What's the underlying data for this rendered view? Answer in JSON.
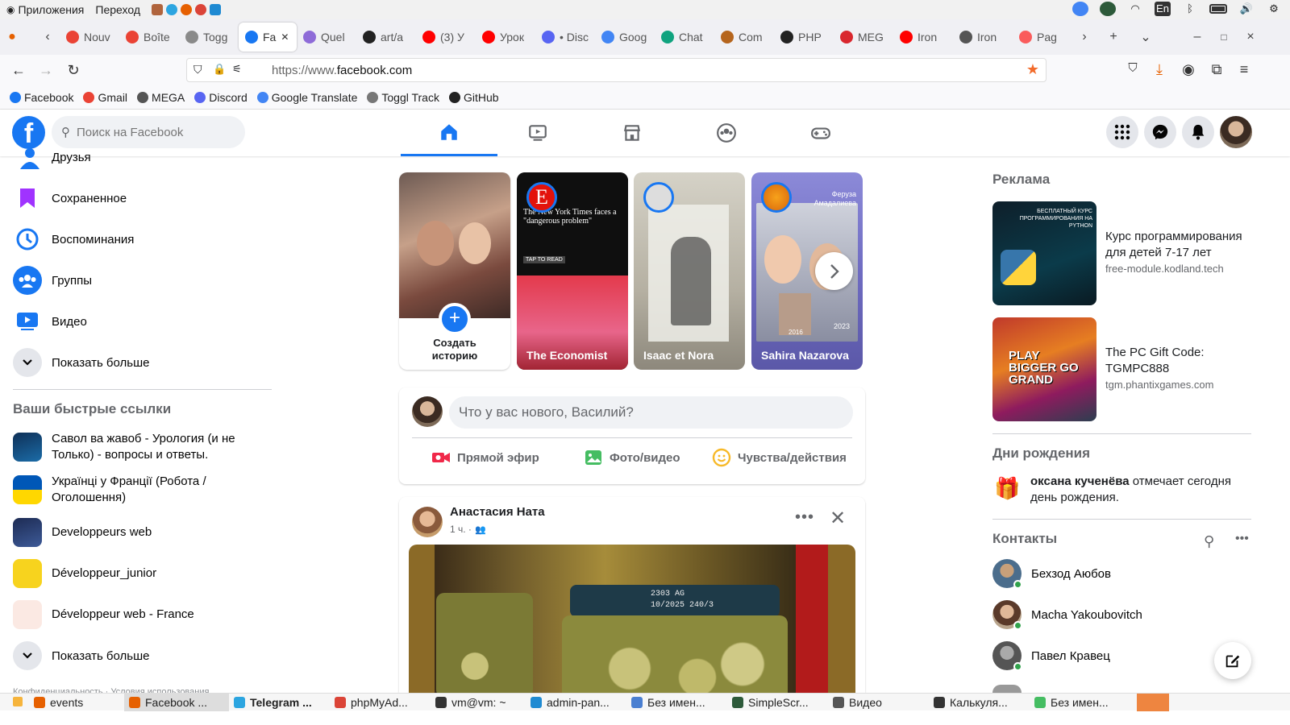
{
  "system_bar": {
    "menu_apps": "Приложения",
    "menu_go": "Переход",
    "keyboard_layout": "En"
  },
  "browser": {
    "tabs": [
      {
        "label": "Nouv",
        "icon": "gmail"
      },
      {
        "label": "Boîte",
        "icon": "gmail"
      },
      {
        "label": "Togg",
        "icon": "toggl"
      },
      {
        "label": "Fa",
        "icon": "facebook"
      },
      {
        "label": "Quel",
        "icon": "quel"
      },
      {
        "label": "art/a",
        "icon": "github"
      },
      {
        "label": "(3) У",
        "icon": "youtube"
      },
      {
        "label": "Урок",
        "icon": "youtube"
      },
      {
        "label": "• Disc",
        "icon": "discord"
      },
      {
        "label": "Goog",
        "icon": "translate"
      },
      {
        "label": "Chat",
        "icon": "chatgpt"
      },
      {
        "label": "Com",
        "icon": "com"
      },
      {
        "label": "PHP",
        "icon": "github"
      },
      {
        "label": "MEG",
        "icon": "mega"
      },
      {
        "label": "Iron",
        "icon": "youtube"
      },
      {
        "label": "Iron",
        "icon": "wikipedia"
      },
      {
        "label": "Pag",
        "icon": "itsy"
      }
    ],
    "url_prefix": "https://www.",
    "url_domain": "facebook.com",
    "bookmarks": [
      {
        "label": "Facebook",
        "icon": "facebook"
      },
      {
        "label": "Gmail",
        "icon": "google"
      },
      {
        "label": "MEGA",
        "icon": "globe"
      },
      {
        "label": "Discord",
        "icon": "discord"
      },
      {
        "label": "Google Translate",
        "icon": "translate"
      },
      {
        "label": "Toggl Track",
        "icon": "toggl"
      },
      {
        "label": "GitHub",
        "icon": "github"
      }
    ]
  },
  "fb": {
    "logo": "f",
    "search_placeholder": "Поиск на Facebook",
    "left_menu": [
      {
        "label": "Друзья",
        "icon": "friends-icon"
      },
      {
        "label": "Сохраненное",
        "icon": "saved-icon"
      },
      {
        "label": "Воспоминания",
        "icon": "memories-icon"
      },
      {
        "label": "Группы",
        "icon": "groups-icon"
      },
      {
        "label": "Видео",
        "icon": "video-icon"
      },
      {
        "label": "Показать больше",
        "icon": "chevron-down-icon"
      }
    ],
    "quick_links_title": "Ваши быстрые ссылки",
    "quick_links": [
      {
        "label": "Савол ва жавоб - Урология (и не Только) - вопросы и ответы."
      },
      {
        "label": "Українці у Франції (Робота / Оголошення)"
      },
      {
        "label": "Developpeurs web"
      },
      {
        "label": "Développeur_junior"
      },
      {
        "label": "Développeur web - France"
      }
    ],
    "show_more_2": "Показать больше",
    "stories": {
      "create_line1": "Создать",
      "create_line2": "историю",
      "items": [
        {
          "name": "The Economist",
          "headline": "The New York Times faces a \"dangerous problem\"",
          "tap": "TAP TO READ"
        },
        {
          "name": "Isaac et Nora"
        },
        {
          "name": "Sahira Nazarova",
          "tag": "Феруза Амадалиева",
          "year1": "2016",
          "year2": "2023"
        }
      ]
    },
    "composer": {
      "placeholder": "Что у вас нового, Василий?",
      "live": "Прямой эфир",
      "photo": "Фото/видео",
      "feeling": "Чувства/действия"
    },
    "post": {
      "author": "Анастасия Ната",
      "time": "1 ч. ·",
      "image_text1": "2303 АG",
      "image_text2": "10/2025 240/3"
    },
    "ads": {
      "title": "Реклама",
      "items": [
        {
          "title": "Курс программирования для детей 7-17 лет",
          "domain": "free-module.kodland.tech",
          "img_text": "БЕСПЛАТНЫЙ КУРС ПРОГРАММИРОВАНИЯ НА PYTHON"
        },
        {
          "title": "The PC Gift Code: TGMPC888",
          "domain": "tgm.phantixgames.com",
          "img_text": "PLAY BIGGER GO GRAND"
        }
      ]
    },
    "birthdays": {
      "title": "Дни рождения",
      "name": "оксана кученёва",
      "text": " отмечает сегодня день рождения."
    },
    "contacts": {
      "title": "Контакты",
      "items": [
        {
          "name": "Бехзод Аюбов"
        },
        {
          "name": "Macha Yakoubovitch"
        },
        {
          "name": "Павел Кравец"
        }
      ]
    },
    "footer_partial": "Конфиденциальность · Условия использования"
  },
  "taskbar": [
    {
      "label": "events"
    },
    {
      "label": "Facebook ..."
    },
    {
      "label": "Telegram ..."
    },
    {
      "label": "phpMyAd..."
    },
    {
      "label": "vm@vm: ~"
    },
    {
      "label": "admin-pan..."
    },
    {
      "label": "Без имен..."
    },
    {
      "label": "SimpleScr..."
    },
    {
      "label": "Видео"
    },
    {
      "label": "Калькуля..."
    },
    {
      "label": "Без имен..."
    }
  ],
  "colors": {
    "fb_blue": "#1877f2",
    "online": "#31a24c"
  }
}
